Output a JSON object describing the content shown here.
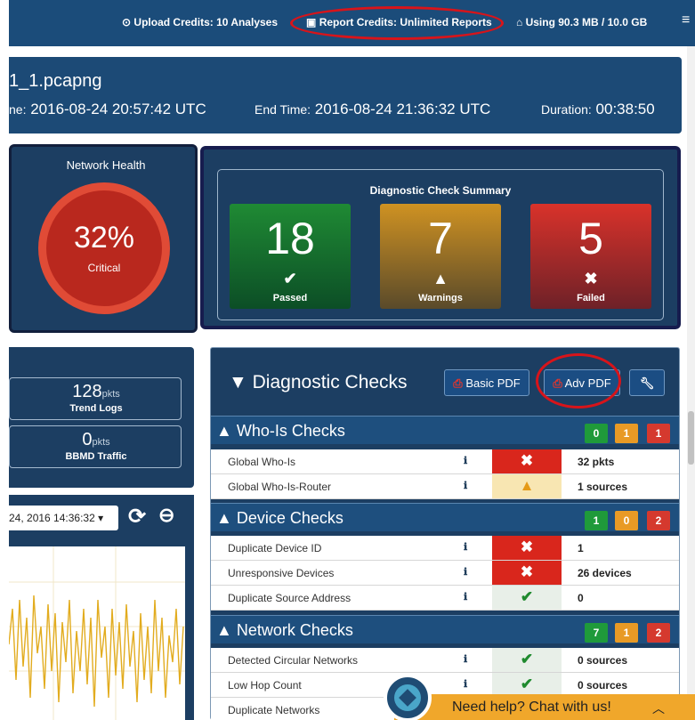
{
  "topbar": {
    "upload_credits": "Upload Credits: 10 Analyses",
    "report_credits": "Report Credits: Unlimited Reports",
    "storage": "Using 90.3 MB / 10.0 GB"
  },
  "file": {
    "name": "1_1.pcapng",
    "start_label": "ne:",
    "start_value": "2016-08-24 20:57:42 UTC",
    "end_label": "End Time:",
    "end_value": "2016-08-24 21:36:32 UTC",
    "duration_label": "Duration:",
    "duration_value": "00:38:50"
  },
  "health": {
    "title": "Network Health",
    "percent": "32%",
    "status": "Critical",
    "level_percent": 32,
    "color": "#b9281e"
  },
  "summary": {
    "title": "Diagnostic Check Summary",
    "passed": {
      "count": "18",
      "label": "Passed"
    },
    "warnings": {
      "count": "7",
      "label": "Warnings"
    },
    "failed": {
      "count": "5",
      "label": "Failed"
    }
  },
  "stats": [
    {
      "value": "128",
      "unit": "pkts",
      "label": "Trend Logs"
    },
    {
      "value": "0",
      "unit": "pkts",
      "label": "BBMD Traffic"
    }
  ],
  "chart_panel": {
    "date_value": "24, 2016 14:36:32"
  },
  "diagnostics": {
    "title": "Diagnostic Checks",
    "basic_pdf": "Basic PDF",
    "adv_pdf": "Adv PDF",
    "sections": [
      {
        "title": "Who-Is Checks",
        "counts": [
          "0",
          "1",
          "1"
        ],
        "rows": [
          {
            "name": "Global Who-Is",
            "status": "fail",
            "value": "32 pkts"
          },
          {
            "name": "Global Who-Is-Router",
            "status": "warn",
            "value": "1 sources"
          }
        ]
      },
      {
        "title": "Device Checks",
        "counts": [
          "1",
          "0",
          "2"
        ],
        "rows": [
          {
            "name": "Duplicate Device ID",
            "status": "fail",
            "value": "1"
          },
          {
            "name": "Unresponsive Devices",
            "status": "fail",
            "value": "26 devices"
          },
          {
            "name": "Duplicate Source Address",
            "status": "pass",
            "value": "0"
          }
        ]
      },
      {
        "title": "Network Checks",
        "counts": [
          "7",
          "1",
          "2"
        ],
        "rows": [
          {
            "name": "Detected Circular Networks",
            "status": "pass",
            "value": "0 sources"
          },
          {
            "name": "Low Hop Count",
            "status": "pass",
            "value": "0 sources"
          },
          {
            "name": "Duplicate Networks",
            "status": "pass",
            "value": ""
          }
        ]
      }
    ]
  },
  "chat": {
    "text": "Need help? Chat with us!"
  },
  "colors": {
    "pass": "#1f9a3a",
    "warn": "#e89a25",
    "fail": "#d5392e",
    "panel": "#1c3e62",
    "highlight": "#d8141a"
  },
  "icons": {
    "upload_credits": "target-icon",
    "report_credits": "pdf-icon",
    "storage": "drive-icon",
    "menu": "hamburger-icon",
    "refresh": "refresh-icon",
    "zoom_out": "zoom-out-icon",
    "settings": "wrench-icon"
  }
}
